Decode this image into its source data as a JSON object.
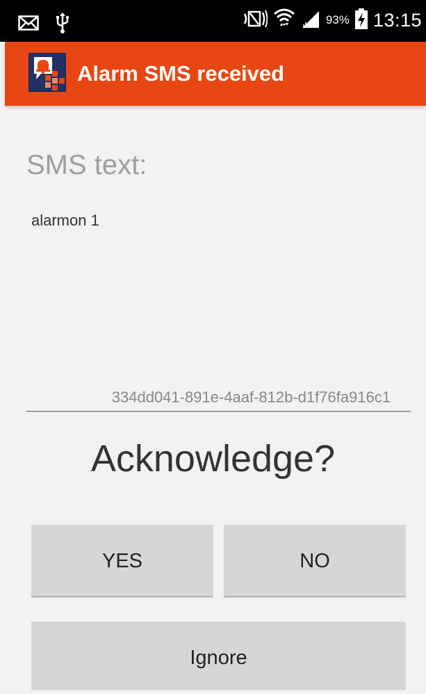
{
  "status_bar": {
    "icons_left": [
      "mail-icon",
      "usb-icon"
    ],
    "icons_right": [
      "nfc-icon",
      "wifi-icon",
      "signal-icon",
      "battery-charging-icon"
    ],
    "battery_percent": "93%",
    "time": "13:15"
  },
  "action_bar": {
    "app_icon": "alarm-sms-app-icon",
    "title": "Alarm SMS received",
    "background_color": "#e84714"
  },
  "content": {
    "sms_label": "SMS text:",
    "sms_text": "alarmon 1",
    "message_id": "334dd041-891e-4aaf-812b-d1f76fa916c1",
    "question": "Acknowledge?"
  },
  "buttons": {
    "yes_label": "YES",
    "no_label": "NO",
    "ignore_label": "Ignore"
  }
}
